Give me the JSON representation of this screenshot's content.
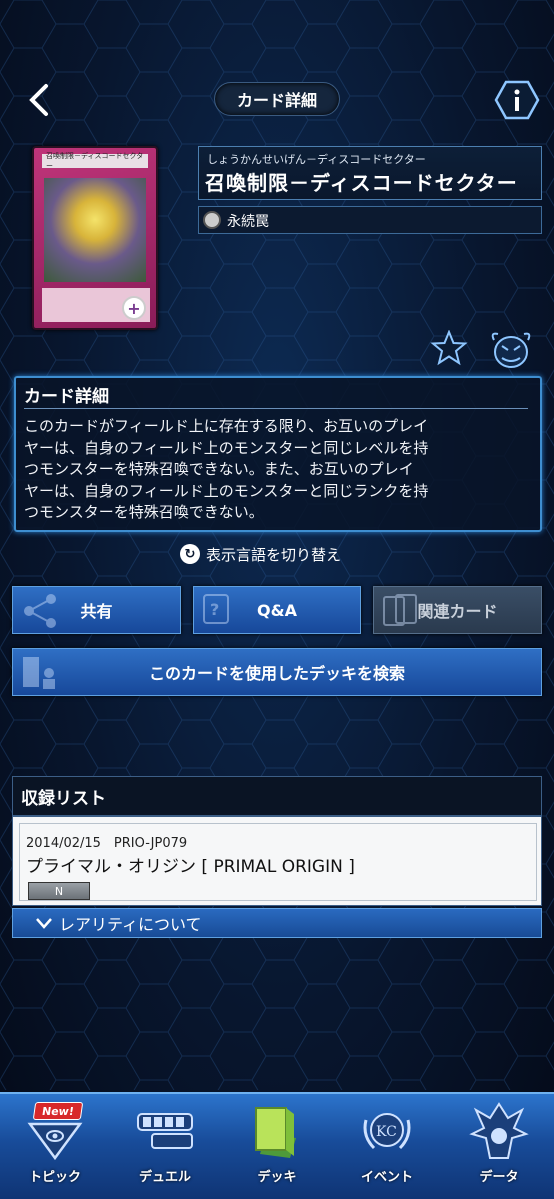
{
  "header": {
    "title": "カード詳細"
  },
  "card": {
    "reading": "しょうかんせいげん－ディスコードセクター",
    "name": "召喚制限－ディスコードセクター",
    "art_name": "召喚制限－ディスコードセクター",
    "type": "永続罠"
  },
  "description": {
    "title": "カード詳細",
    "lines": [
      "このカードがフィールド上に存在する限り、お互いのプレイ",
      "ヤーは、自身のフィールド上のモンスターと同じレベルを持",
      "つモンスターを特殊召喚できない。また、お互いのプレイ",
      "ヤーは、自身のフィールド上のモンスターと同じランクを持",
      "つモンスターを特殊召喚できない。"
    ]
  },
  "lang_switch": "表示言語を切り替え",
  "buttons": {
    "share": "共有",
    "qa": "Q&A",
    "related": "関連カード",
    "search_decks": "このカードを使用したデッキを検索"
  },
  "release_list": {
    "title": "収録リスト",
    "items": [
      {
        "date_code": "2014/02/15　PRIO-JP079",
        "name": "プライマル・オリジン [ PRIMAL ORIGIN ]",
        "rarity": "N"
      }
    ],
    "rarity_toggle": "レアリティについて"
  },
  "nav": {
    "new_badge": "New!",
    "items": [
      {
        "label": "トピック"
      },
      {
        "label": "デュエル"
      },
      {
        "label": "デッキ"
      },
      {
        "label": "イベント"
      },
      {
        "label": "データ"
      }
    ]
  },
  "colors": {
    "accent": "#2f6fc4",
    "border_glow": "#3e8ed0",
    "card_frame": "#c0357a",
    "badge": "#d8282a"
  }
}
